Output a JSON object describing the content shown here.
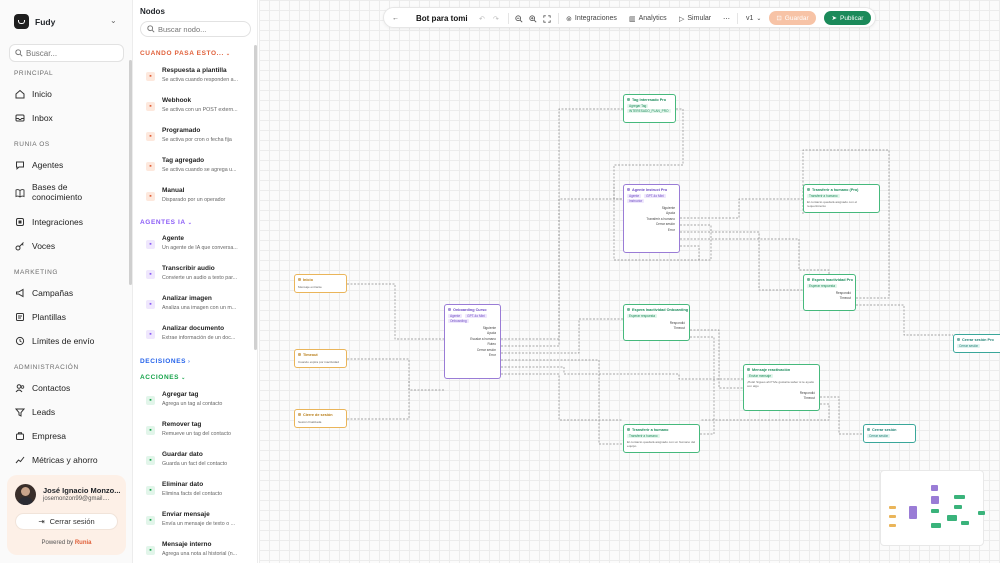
{
  "brand": {
    "name": "Fudy"
  },
  "sidebar": {
    "search_placeholder": "Buscar...",
    "sections": {
      "principal": "PRINCIPAL",
      "runia": "RUNIA OS",
      "marketing": "MARKETING",
      "admin": "ADMINISTRACIÓN"
    },
    "items": [
      {
        "label": "Inicio",
        "icon": "home-icon"
      },
      {
        "label": "Inbox",
        "icon": "inbox-icon"
      },
      {
        "label": "Agentes",
        "icon": "chat-icon"
      },
      {
        "label": "Bases de conocimiento",
        "icon": "book-icon"
      },
      {
        "label": "Integraciones",
        "icon": "plug-icon"
      },
      {
        "label": "Voces",
        "icon": "key-icon"
      },
      {
        "label": "Campañas",
        "icon": "megaphone-icon"
      },
      {
        "label": "Plantillas",
        "icon": "template-icon"
      },
      {
        "label": "Límites de envío",
        "icon": "limit-icon"
      },
      {
        "label": "Contactos",
        "icon": "contacts-icon"
      },
      {
        "label": "Leads",
        "icon": "leads-icon"
      },
      {
        "label": "Empresa",
        "icon": "company-icon"
      },
      {
        "label": "Métricas y ahorro",
        "icon": "metrics-icon"
      }
    ],
    "user": {
      "name": "José Ignacio Monzo...",
      "email": "josemonzon99@gmail....",
      "logout": "Cerrar sesión",
      "powered_prefix": "Powered by",
      "powered_brand": "Runia"
    }
  },
  "nodes_panel": {
    "title": "Nodos",
    "search_placeholder": "Buscar nodo...",
    "groups": {
      "triggers": "CUANDO PASA ESTO...",
      "agents": "AGENTES IA",
      "decisions": "DECISIONES",
      "actions": "ACCIONES"
    },
    "colors": {
      "triggers": "#e0603a",
      "agents": "#8b5cf6",
      "decisions": "#2563eb",
      "actions": "#16a34a"
    },
    "triggers": [
      {
        "title": "Respuesta a plantilla",
        "desc": "Se activa cuando responden a..."
      },
      {
        "title": "Webhook",
        "desc": "Se activa con un POST extern..."
      },
      {
        "title": "Programado",
        "desc": "Se activa por cron o fecha fija"
      },
      {
        "title": "Tag agregado",
        "desc": "Se activa cuando se agrega u..."
      },
      {
        "title": "Manual",
        "desc": "Disparado por un operador"
      }
    ],
    "agents": [
      {
        "title": "Agente",
        "desc": "Un agente de IA que conversa..."
      },
      {
        "title": "Transcribir audio",
        "desc": "Convierte un audio a texto par..."
      },
      {
        "title": "Analizar imagen",
        "desc": "Analiza una imagen con un m..."
      },
      {
        "title": "Analizar documento",
        "desc": "Extrae información de un doc..."
      }
    ],
    "actions": [
      {
        "title": "Agregar tag",
        "desc": "Agrega un tag al contacto"
      },
      {
        "title": "Remover tag",
        "desc": "Remueve un tag del contacto"
      },
      {
        "title": "Guardar dato",
        "desc": "Guarda un fact del contacto"
      },
      {
        "title": "Eliminar dato",
        "desc": "Elimina facts del contacto"
      },
      {
        "title": "Enviar mensaje",
        "desc": "Envía un mensaje de texto o ..."
      },
      {
        "title": "Mensaje interno",
        "desc": "Agrega una nota al historial (n..."
      }
    ]
  },
  "toolbar": {
    "title": "Bot para tomi",
    "integrations": "Integraciones",
    "analytics": "Analytics",
    "simulate": "Simular",
    "version": "v1",
    "save": "Guardar",
    "publish": "Publicar"
  },
  "flow": {
    "inicio": {
      "title": "Inicio",
      "desc": "Mensaje entrante"
    },
    "timeout": {
      "title": "Timeout",
      "desc": "Cuando expira por inactividad"
    },
    "cierre": {
      "title": "Cierre de sesión",
      "desc": "Sesión finalizada"
    },
    "onboarding": {
      "title": "Onboarding Curso",
      "pill1": "Agente",
      "pill2": "GPT-4o Mini",
      "pill3": "Onboarding",
      "rows": [
        "Siguiente",
        "Ayuda",
        "Escalar a humano",
        "Ruteo",
        "Cerrar sesión",
        "Error"
      ]
    },
    "tag_pro": {
      "title": "Tag Interesado Pro",
      "pill": "Agregar Tag",
      "tag": "INTERESADO_PLAN_PRO"
    },
    "agente_pro": {
      "title": "Agente Instruct Pro",
      "pill1": "Agente",
      "pill2": "GPT-4o Mini",
      "pill3": "Instructor",
      "rows": [
        "Siguiente",
        "Ayuda",
        "Transferir a humano",
        "Cerrar sesión",
        "Error"
      ]
    },
    "transfer_pro": {
      "title": "Transferir a humano (Pro)",
      "pill": "Transferir a humano",
      "desc": "El contacto quedará asignado con el requerimiento"
    },
    "espera_pro": {
      "title": "Espera inactividad Pro",
      "pill": "Esperar respuesta",
      "rows": [
        "Respondió",
        "Timeout"
      ]
    },
    "espera_onb": {
      "title": "Espera Inactividad Onboarding",
      "pill": "Esperar respuesta",
      "rows": [
        "Respondió",
        "Timeout"
      ]
    },
    "msg_reac": {
      "title": "Mensaje reactivación",
      "pill": "Enviar mensaje",
      "desc": "¡Hola! Sigues ahí? Me gustaría saber si te ayudo con algo",
      "rows": [
        "Respondió",
        "Timeout"
      ]
    },
    "transfer": {
      "title": "Transferir a humano",
      "pill": "Transferir a humano",
      "desc": "El contacto quedará asignado con un humano del equipo"
    },
    "cerrar": {
      "title": "Cerrar sesión",
      "pill": "Cerrar sesión"
    },
    "cerrar_right": {
      "title": "Cerrar sesión Pro",
      "pill": "Cerrar sesión"
    }
  }
}
